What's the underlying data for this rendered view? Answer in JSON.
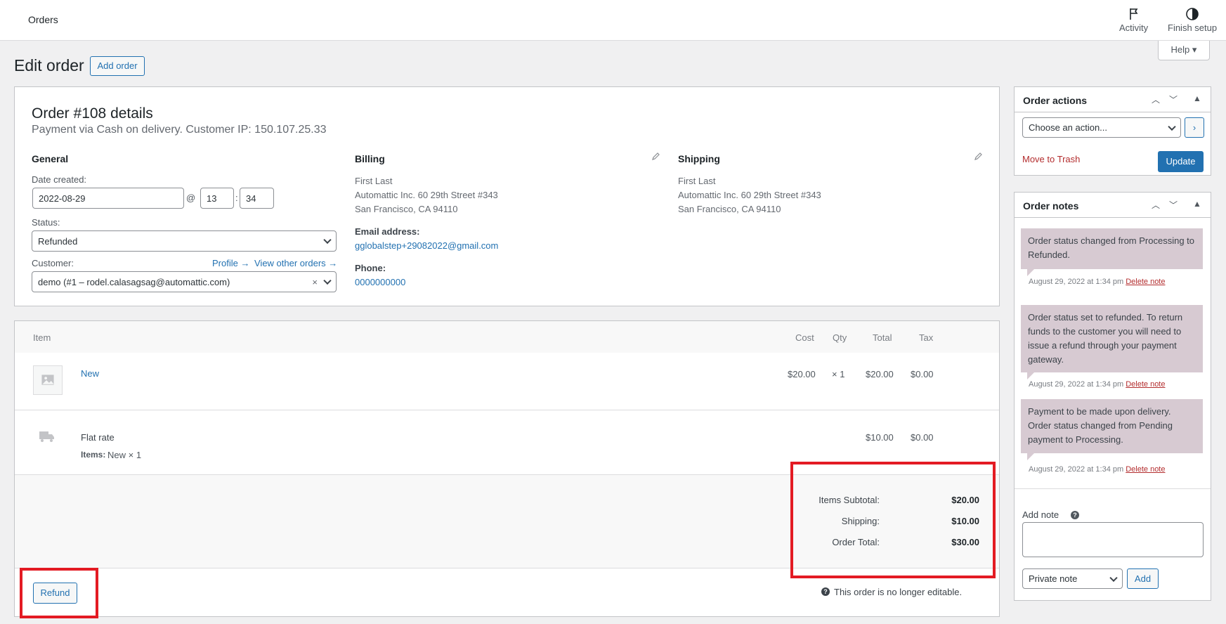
{
  "topbar": {
    "title": "Orders",
    "activity_label": "Activity",
    "finish_setup_label": "Finish setup",
    "help_label": "Help"
  },
  "page": {
    "title": "Edit order",
    "add_order_label": "Add order"
  },
  "order": {
    "heading": "Order #108 details",
    "subheading": "Payment via Cash on delivery. Customer IP: 150.107.25.33",
    "general": {
      "heading": "General",
      "date_label": "Date created:",
      "date_value": "2022-08-29",
      "at_sign": "@",
      "hour": "13",
      "colon": ":",
      "minute": "34",
      "status_label": "Status:",
      "status_value": "Refunded",
      "customer_label": "Customer:",
      "profile_link": "Profile →",
      "view_other_orders_link": "View other orders →",
      "customer_value": "demo (#1 – rodel.calasagsag@automattic.com)",
      "clear_symbol": "×"
    },
    "billing": {
      "heading": "Billing",
      "name": "First Last",
      "address1": "Automattic Inc. 60 29th Street #343",
      "address2": "San Francisco, CA 94110",
      "email_label": "Email address:",
      "email": "gglobalstep+29082022@gmail.com",
      "phone_label": "Phone:",
      "phone": "0000000000"
    },
    "shipping": {
      "heading": "Shipping",
      "name": "First Last",
      "address1": "Automattic Inc. 60 29th Street #343",
      "address2": "San Francisco, CA 94110"
    }
  },
  "items": {
    "headers": {
      "item": "Item",
      "cost": "Cost",
      "qty": "Qty",
      "total": "Total",
      "tax": "Tax"
    },
    "product": {
      "name": "New",
      "cost": "$20.00",
      "qty": "× 1",
      "total": "$20.00",
      "tax": "$0.00"
    },
    "shipping_line": {
      "name": "Flat rate",
      "items_label": "Items:",
      "items_value": "New × 1",
      "total": "$10.00",
      "tax": "$0.00"
    },
    "totals": {
      "subtotal_label": "Items Subtotal:",
      "subtotal_value": "$20.00",
      "shipping_label": "Shipping:",
      "shipping_value": "$10.00",
      "order_total_label": "Order Total:",
      "order_total_value": "$30.00"
    },
    "refund_label": "Refund",
    "not_editable_text": "This order is no longer editable."
  },
  "order_actions": {
    "title": "Order actions",
    "select_value": "Choose an action...",
    "move_to_trash": "Move to Trash",
    "update_label": "Update"
  },
  "order_notes": {
    "title": "Order notes",
    "notes": [
      {
        "text": "Order status changed from Processing to Refunded.",
        "date": "August 29, 2022 at 1:34 pm",
        "delete": "Delete note"
      },
      {
        "text": "Order status set to refunded. To return funds to the customer you will need to issue a refund through your payment gateway.",
        "date": "August 29, 2022 at 1:34 pm",
        "delete": "Delete note"
      },
      {
        "text": "Payment to be made upon delivery. Order status changed from Pending payment to Processing.",
        "date": "August 29, 2022 at 1:34 pm",
        "delete": "Delete note"
      }
    ],
    "add_note_label": "Add note",
    "note_type_value": "Private note",
    "add_button": "Add"
  },
  "colors": {
    "accent": "#2271b1",
    "note_bg": "#d7cad2",
    "highlight": "#e31b23"
  }
}
